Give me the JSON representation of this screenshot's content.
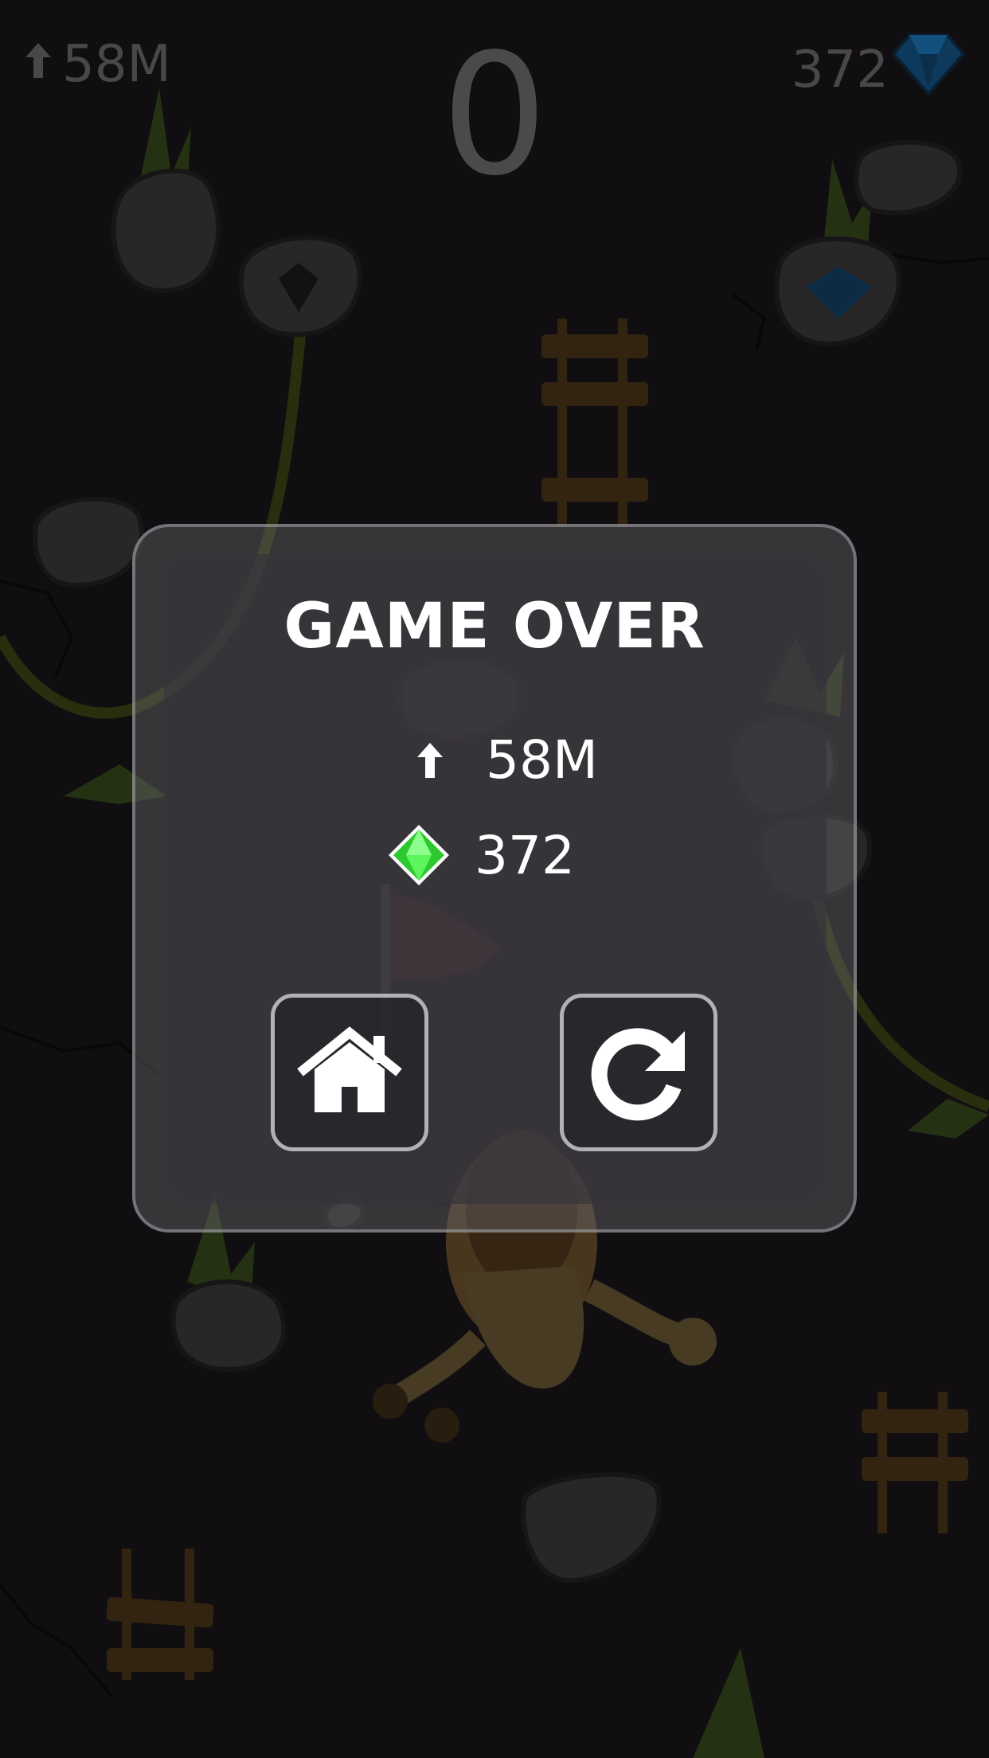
{
  "hud": {
    "height": "58M",
    "score": "0",
    "gems": "372"
  },
  "game_over": {
    "title": "GAME OVER",
    "height": "58M",
    "gems": "372"
  },
  "icons": {
    "height": "up-arrow-icon",
    "gems_hud": "blue-diamond-icon",
    "gems_panel": "green-gem-icon",
    "home": "home-icon",
    "retry": "restart-icon"
  },
  "colors": {
    "background": "#141114",
    "panel_border": "#b3b1b5",
    "gem_green": "#3ee63e",
    "gem_blue": "#1d6fb0",
    "flag_red": "#c0272d"
  }
}
